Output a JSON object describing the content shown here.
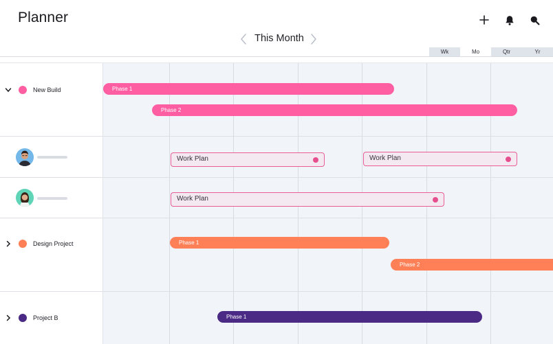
{
  "app": {
    "title": "Planner"
  },
  "header": {
    "icons": [
      "plus-icon",
      "bell-icon",
      "search-icon"
    ]
  },
  "nav": {
    "label": "This Month"
  },
  "scale": {
    "options": [
      "Wk",
      "Mo",
      "Qtr",
      "Yr"
    ],
    "active": "Mo"
  },
  "colors": {
    "pink": "#ff5fa2",
    "orange": "#ff7f57",
    "purple": "#4b2a86",
    "outline": "#e85d96"
  },
  "rows": {
    "new_build": {
      "label": "New Build",
      "phase1": "Phase 1",
      "phase2": "Phase 2"
    },
    "person1": {
      "task1": "Work Plan",
      "task2": "Work Plan"
    },
    "person2": {
      "task1": "Work Plan"
    },
    "design_project": {
      "label": "Design Project",
      "phase1": "Phase 1",
      "phase2": "Phase 2"
    },
    "project_b": {
      "label": "Project B",
      "phase1": "Phase 1"
    }
  }
}
